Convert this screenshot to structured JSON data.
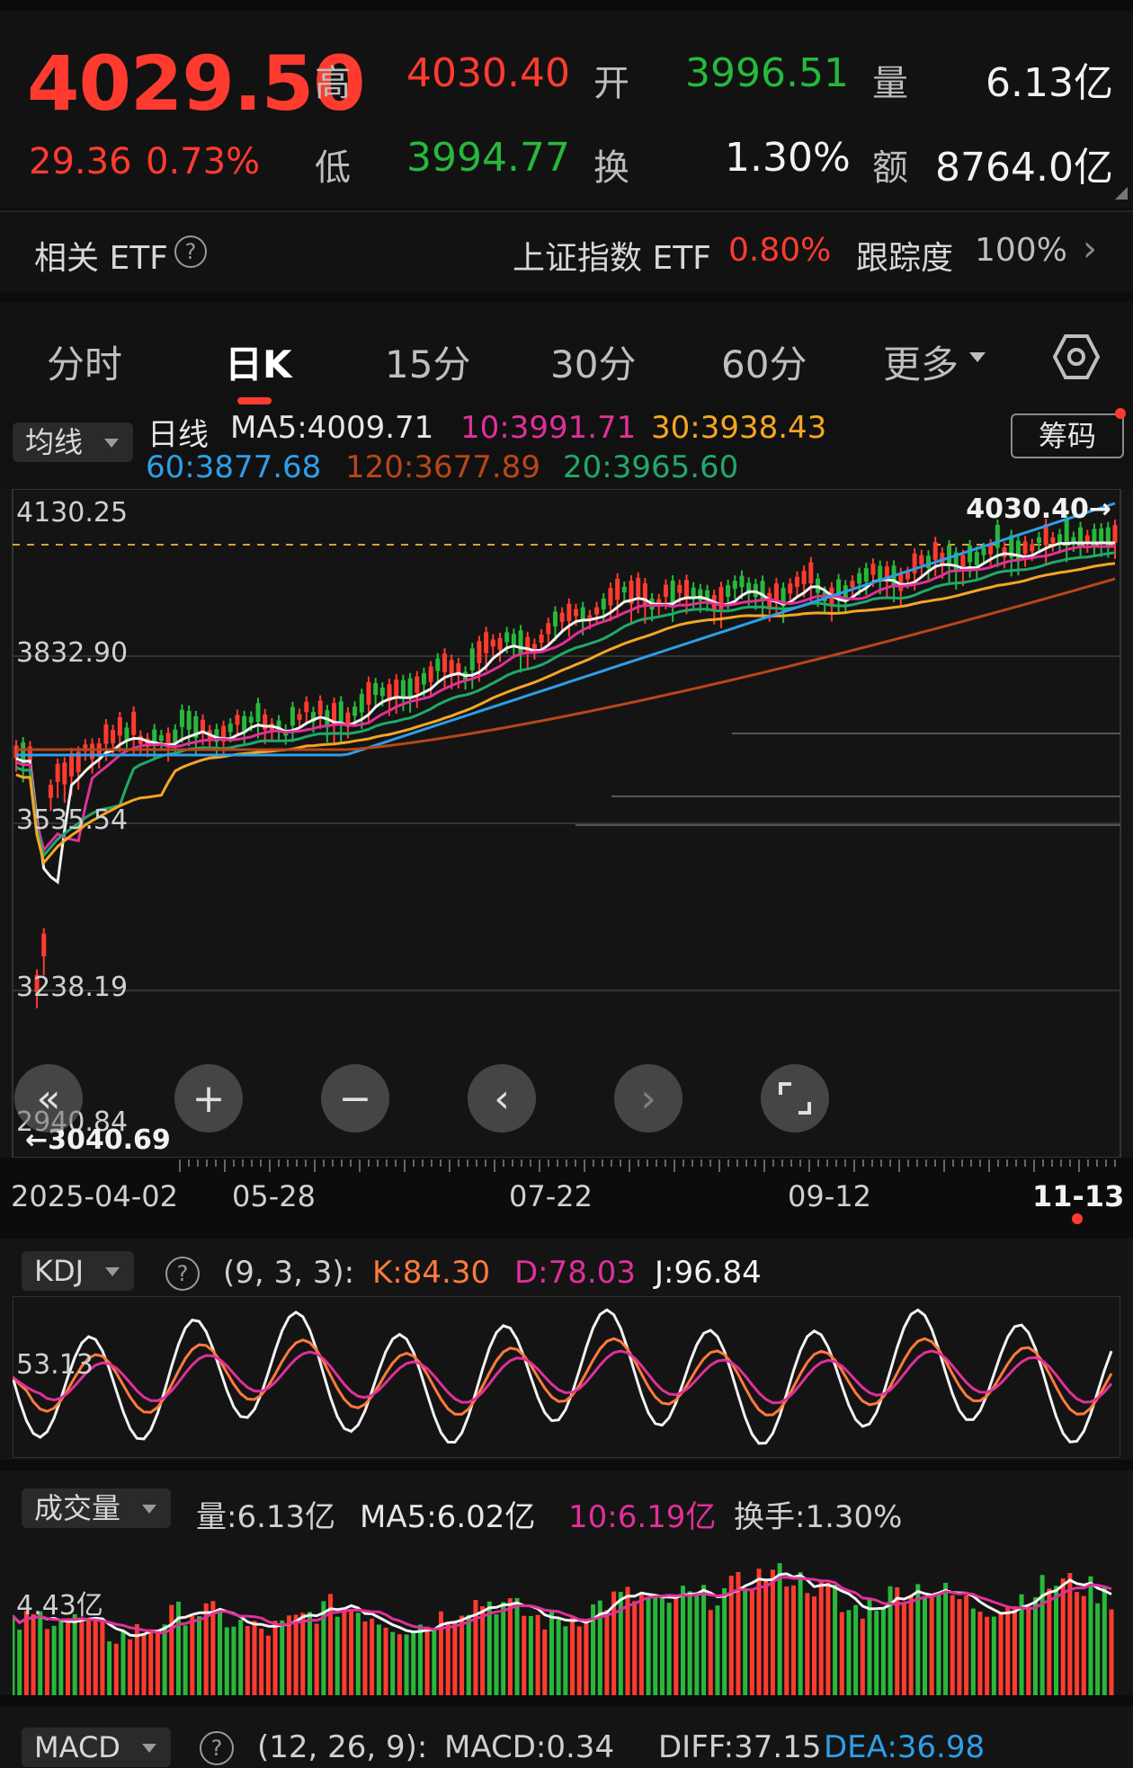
{
  "quote": {
    "price": "4029.50",
    "change": "29.36",
    "change_pct": "0.73%",
    "labels": {
      "high": "高",
      "open": "开",
      "volume": "量",
      "low": "低",
      "turnover": "换",
      "amount": "额"
    },
    "high": "4030.40",
    "open": "3996.51",
    "volume": "6.13亿",
    "low": "3994.77",
    "turnover": "1.30%",
    "amount": "8764.0亿"
  },
  "etf": {
    "label": "相关 ETF",
    "name": "上证指数 ETF",
    "pct": "0.80%",
    "track_label": "跟踪度",
    "track": "100%"
  },
  "tabs": [
    "分时",
    "日K",
    "15分",
    "30分",
    "60分",
    "更多"
  ],
  "active_tab": 1,
  "ma_bar": {
    "selector": "均线",
    "line_label": "日线",
    "ma5": "MA5:4009.71",
    "ma10": "10:3991.71",
    "ma30": "30:3938.43",
    "ma60": "60:3877.68",
    "ma120": "120:3677.89",
    "ma20": "20:3965.60",
    "chip_button": "筹码"
  },
  "price_axis": [
    "4130.25",
    "3832.90",
    "3535.54",
    "3238.19",
    "2940.84"
  ],
  "max_marker": "4030.40→",
  "min_marker": "←3040.69",
  "dates": [
    "2025-04-02",
    "05-28",
    "07-22",
    "09-12",
    "11-13"
  ],
  "kdj": {
    "selector": "KDJ",
    "params": "(9, 3, 3):",
    "k": "K:84.30",
    "d": "D:78.03",
    "j": "J:96.84",
    "axis": "53.13"
  },
  "vol": {
    "selector": "成交量",
    "vol": "量:6.13亿",
    "ma5": "MA5:6.02亿",
    "ma10": "10:6.19亿",
    "turnover": "换手:1.30%",
    "axis": "4.43亿"
  },
  "macd": {
    "selector": "MACD",
    "params": "(12, 26, 9):",
    "macd": "MACD:0.34",
    "diff": "DIFF:37.15",
    "dea": "DEA:36.98"
  },
  "colors": {
    "up": "#ff3b30",
    "down": "#28b83c",
    "ma5": "#f2f2f2",
    "ma10": "#e0309a",
    "ma20": "#22a86b",
    "ma30": "#f5a623",
    "ma60": "#2f9ee8",
    "ma120": "#b8461a"
  },
  "icons": [
    "help-icon",
    "chevron-right-icon",
    "gear-hexagon-icon",
    "caret-down-icon",
    "double-left-icon",
    "zoom-in-icon",
    "zoom-out-icon",
    "left-icon",
    "right-icon",
    "fullscreen-icon"
  ]
}
